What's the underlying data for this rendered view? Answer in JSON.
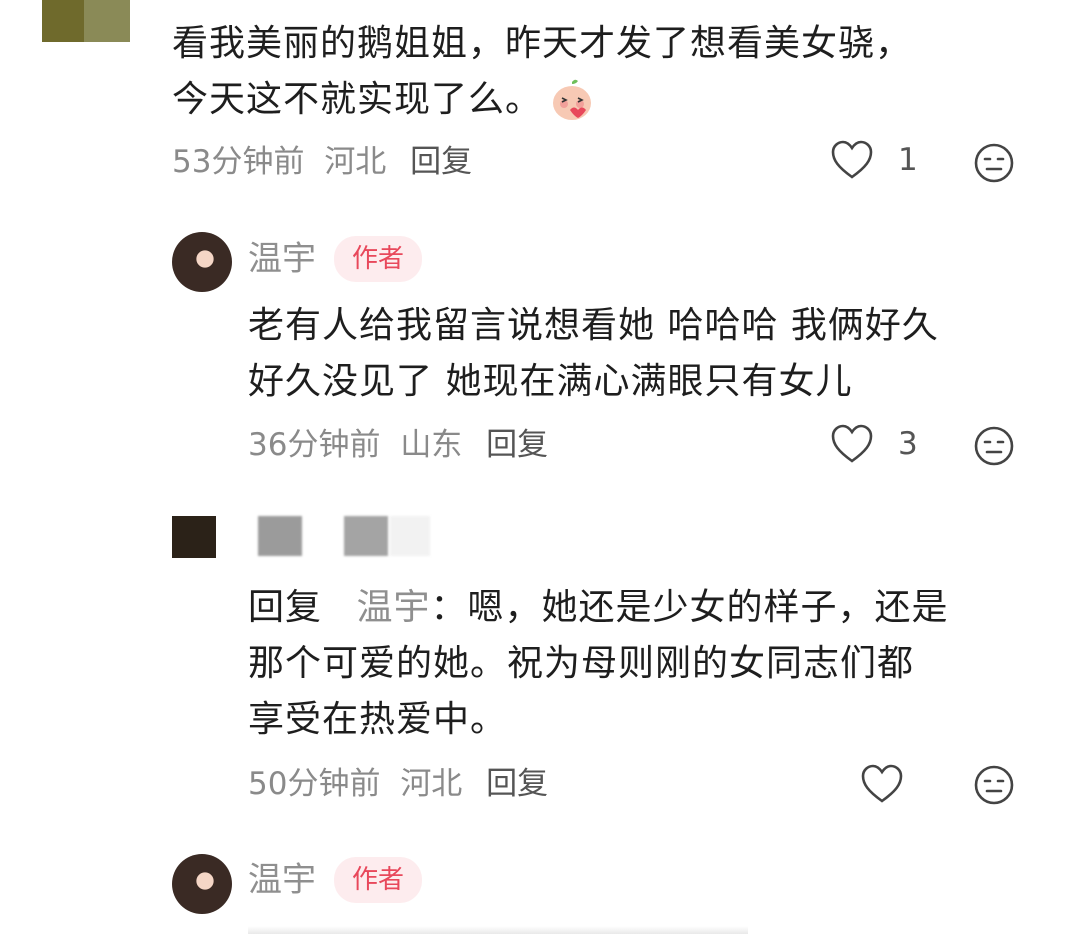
{
  "comments": [
    {
      "text_line1": "看我美丽的鹅姐姐，昨天才发了想看美女骁，",
      "text_line2": "今天这不就实现了么。",
      "emoji": "peach-blush-emoji",
      "time": "53分钟前",
      "location": "河北",
      "reply_label": "回复",
      "likes": "1"
    },
    {
      "author": "温宇",
      "badge": "作者",
      "text_line1": "老有人给我留言说想看她 哈哈哈 我俩好久",
      "text_line2": "好久没见了 她现在满心满眼只有女儿",
      "time": "36分钟前",
      "location": "山东",
      "reply_label": "回复",
      "likes": "3"
    },
    {
      "reply_prefix": "回复",
      "reply_to": "温宇",
      "reply_colon": "：",
      "text_line1_rest": "嗯，她还是少女的样子，还是",
      "text_line2": "那个可爱的她。祝为母则刚的女同志们都",
      "text_line3": "享受在热爱中。",
      "time": "50分钟前",
      "location": "河北",
      "reply_label": "回复",
      "likes": ""
    },
    {
      "author": "温宇",
      "badge": "作者"
    }
  ],
  "colors": {
    "badge_bg": "#fdecee",
    "badge_text": "#e8485b",
    "meta_gray": "#8a8a8a"
  }
}
